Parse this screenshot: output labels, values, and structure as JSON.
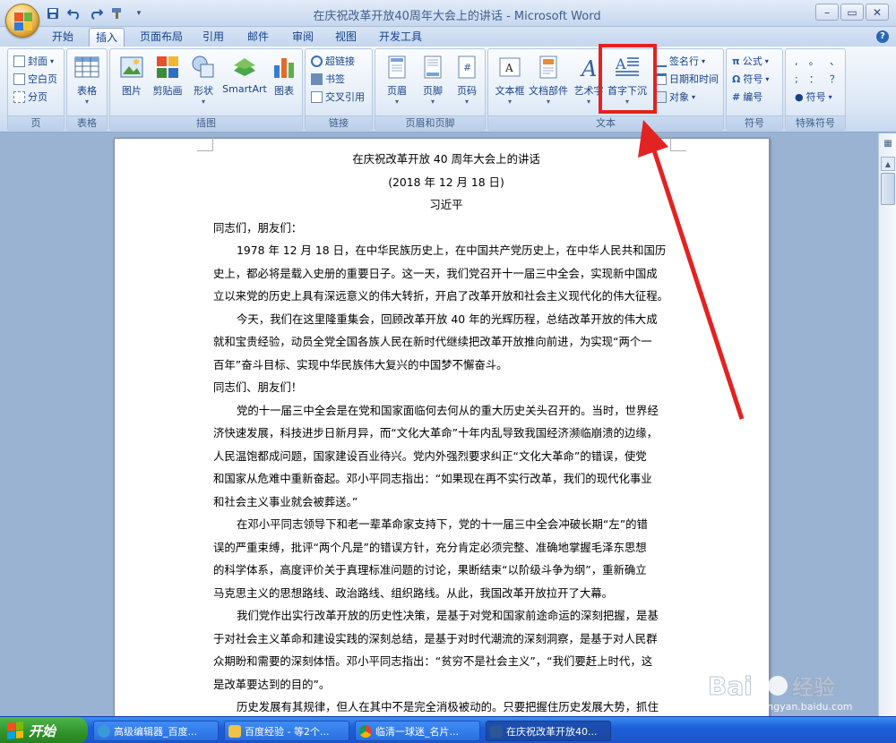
{
  "window": {
    "title": "在庆祝改革开放40周年大会上的讲话 - Microsoft Word",
    "controls": [
      "minimize-icon",
      "maximize-icon",
      "close-icon"
    ]
  },
  "qat": [
    "save-icon",
    "undo-icon",
    "redo-icon",
    "format-painter-icon"
  ],
  "tabs": [
    {
      "label": "开始",
      "active": false
    },
    {
      "label": "插入",
      "active": true
    },
    {
      "label": "页面布局",
      "active": false
    },
    {
      "label": "引用",
      "active": false
    },
    {
      "label": "邮件",
      "active": false
    },
    {
      "label": "审阅",
      "active": false
    },
    {
      "label": "视图",
      "active": false
    },
    {
      "label": "开发工具",
      "active": false
    }
  ],
  "ribbon": {
    "pages": {
      "label": "页",
      "items": [
        "封面",
        "空白页",
        "分页"
      ]
    },
    "table": {
      "label": "表格",
      "button": "表格"
    },
    "illustrations": {
      "label": "插图",
      "buttons": [
        "图片",
        "剪贴画",
        "形状",
        "SmartArt",
        "图表"
      ]
    },
    "links": {
      "label": "链接",
      "items": [
        "超链接",
        "书签",
        "交叉引用"
      ]
    },
    "header_footer": {
      "label": "页眉和页脚",
      "buttons": [
        "页眉",
        "页脚",
        "页码"
      ]
    },
    "text": {
      "label": "文本",
      "buttons": [
        "文本框",
        "文档部件",
        "艺术字",
        "首字下沉"
      ],
      "items": [
        "签名行",
        "日期和时间",
        "对象"
      ]
    },
    "symbols": {
      "label": "符号",
      "items": [
        "公式",
        "符号",
        "编号"
      ]
    },
    "special": {
      "label": "特殊符号",
      "items": [
        ",",
        "。",
        "、",
        ";",
        "：",
        "？",
        "符号"
      ]
    }
  },
  "document": {
    "title": "在庆祝改革开放 40 周年大会上的讲话",
    "date": "(2018 年 12 月 18 日)",
    "author": "习近平",
    "lines": [
      {
        "t": "同志们，朋友们：",
        "i": false
      },
      {
        "t": "1978 年 12 月 18 日，在中华民族历史上，在中国共产党历史上，在中华人民共和国历",
        "i": true
      },
      {
        "t": "史上，都必将是载入史册的重要日子。这一天，我们党召开十一届三中全会，实现新中国成",
        "i": false
      },
      {
        "t": "立以来党的历史上具有深远意义的伟大转折，开启了改革开放和社会主义现代化的伟大征程。",
        "i": false
      },
      {
        "t": "今天，我们在这里隆重集会，回顾改革开放 40 年的光辉历程，总结改革开放的伟大成",
        "i": true
      },
      {
        "t": "就和宝贵经验，动员全党全国各族人民在新时代继续把改革开放推向前进，为实现“两个一",
        "i": false
      },
      {
        "t": "百年”奋斗目标、实现中华民族伟大复兴的中国梦不懈奋斗。",
        "i": false
      },
      {
        "t": "同志们、朋友们！",
        "i": false
      },
      {
        "t": "党的十一届三中全会是在党和国家面临何去何从的重大历史关头召开的。当时，世界经",
        "i": true
      },
      {
        "t": "济快速发展，科技进步日新月异，而“文化大革命”十年内乱导致我国经济濒临崩溃的边缘，",
        "i": false
      },
      {
        "t": "人民温饱都成问题，国家建设百业待兴。党内外强烈要求纠正“文化大革命”的错误，使党",
        "i": false
      },
      {
        "t": "和国家从危难中重新奋起。邓小平同志指出：“如果现在再不实行改革，我们的现代化事业",
        "i": false
      },
      {
        "t": "和社会主义事业就会被葬送。”",
        "i": false
      },
      {
        "t": "在邓小平同志领导下和老一辈革命家支持下，党的十一届三中全会冲破长期“左”的错",
        "i": true
      },
      {
        "t": "误的严重束缚，批评“两个凡是”的错误方针，充分肯定必须完整、准确地掌握毛泽东思想",
        "i": false
      },
      {
        "t": "的科学体系，高度评价关于真理标准问题的讨论，果断结束“以阶级斗争为纲”，重新确立",
        "i": false
      },
      {
        "t": "马克思主义的思想路线、政治路线、组织路线。从此，我国改革开放拉开了大幕。",
        "i": false
      },
      {
        "t": "我们党作出实行改革开放的历史性决策，是基于对党和国家前途命运的深刻把握，是基",
        "i": true
      },
      {
        "t": "于对社会主义革命和建设实践的深刻总结，是基于对时代潮流的深刻洞察，是基于对人民群",
        "i": false
      },
      {
        "t": "众期盼和需要的深刻体悟。邓小平同志指出：“贫穷不是社会主义”，“我们要赶上时代，这",
        "i": false
      },
      {
        "t": "是改革要达到的目的”。",
        "i": false
      },
      {
        "t": "历史发展有其规律，但人在其中不是完全消极被动的。只要把握住历史发展大势，抓住",
        "i": true
      }
    ]
  },
  "taskbar": {
    "start": "开始",
    "tasks": [
      {
        "label": "高级编辑器_百度...",
        "active": false,
        "icon": "ie-icon"
      },
      {
        "label": "百度经验 - 等2个...",
        "active": false,
        "icon": "folder-icon"
      },
      {
        "label": "临清一球迷_名片...",
        "active": false,
        "icon": "chrome-icon"
      },
      {
        "label": "在庆祝改革开放40...",
        "active": true,
        "icon": "word-icon"
      }
    ]
  },
  "watermark": {
    "brand": "Baidu",
    "sub": "经验",
    "url": "jingyan.baidu.com"
  },
  "colors": {
    "highlight": "#e32222",
    "arrow": "#e32222",
    "ribbon": "#dce7f5",
    "taskbar": "#2a6fe1"
  }
}
